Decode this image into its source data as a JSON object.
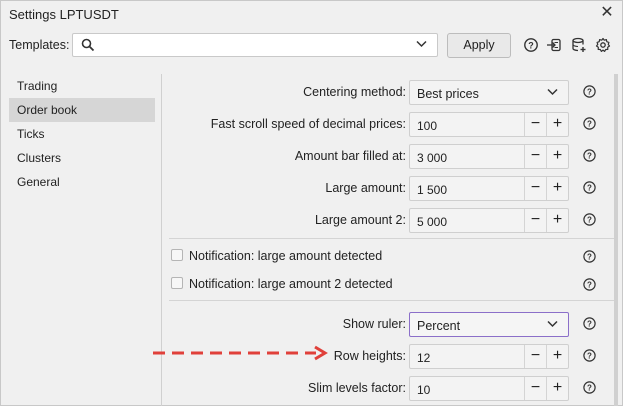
{
  "window": {
    "title": "Settings LPTUSDT"
  },
  "templates": {
    "label": "Templates:",
    "value": "",
    "apply_label": "Apply"
  },
  "sidebar": {
    "items": [
      {
        "label": "Trading",
        "active": false
      },
      {
        "label": "Order book",
        "active": true
      },
      {
        "label": "Ticks",
        "active": false
      },
      {
        "label": "Clusters",
        "active": false
      },
      {
        "label": "General",
        "active": false
      }
    ]
  },
  "settings": {
    "centering_method": {
      "label": "Centering method:",
      "value": "Best prices"
    },
    "fast_scroll": {
      "label": "Fast scroll speed of decimal prices:",
      "value": "100"
    },
    "amount_bar": {
      "label": "Amount bar filled at:",
      "value": "3 000"
    },
    "large_amount": {
      "label": "Large amount:",
      "value": "1 500"
    },
    "large_amount_2": {
      "label": "Large amount 2:",
      "value": "5 000"
    },
    "notif_large": {
      "label": "Notification: large amount detected",
      "checked": false
    },
    "notif_large_2": {
      "label": "Notification: large amount 2 detected",
      "checked": false
    },
    "show_ruler": {
      "label": "Show ruler:",
      "value": "Percent"
    },
    "row_heights": {
      "label": "Row heights:",
      "value": "12"
    },
    "slim_levels": {
      "label": "Slim levels factor:",
      "value": "10"
    }
  },
  "icons": {
    "help": "help-circle-icon",
    "accent_arrow_color": "#e0403a",
    "focus_border_color": "#8b6fc9"
  }
}
